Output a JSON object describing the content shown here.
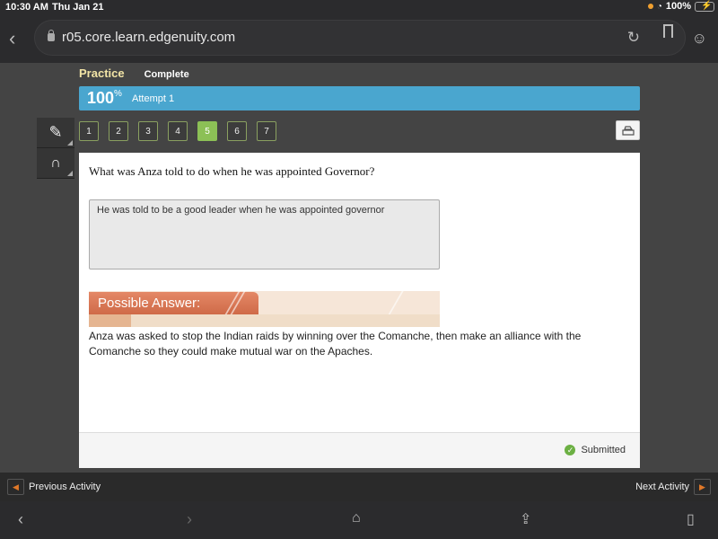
{
  "status_bar": {
    "time": "10:30 AM",
    "date": "Thu Jan 21",
    "battery": "100%",
    "icons": [
      "recording-dot-icon",
      "wifi-icon",
      "battery-charging-icon"
    ]
  },
  "browser": {
    "url": "r05.core.learn.edgenuity.com",
    "icons": [
      "back-icon",
      "lock-icon",
      "reload-icon",
      "bookmark-icon",
      "reader-icon"
    ]
  },
  "activity": {
    "mode": "Practice",
    "status": "Complete",
    "score": "100",
    "score_suffix": "%",
    "attempt": "Attempt 1",
    "accent_color": "#4aa6cf"
  },
  "tools": [
    {
      "icon": "pencil-icon"
    },
    {
      "icon": "headphones-icon"
    }
  ],
  "question_nav": {
    "items": [
      "1",
      "2",
      "3",
      "4",
      "5",
      "6",
      "7"
    ],
    "active": "5"
  },
  "question": {
    "text": "What was Anza told to do when he was appointed Governor?",
    "response": "He was told to be a good leader when he was appointed governor",
    "possible_answer_label": "Possible Answer:",
    "possible_answer": "Anza was asked to stop the Indian raids by winning over the Comanche, then make an alliance with the Comanche so they could make mutual war on the Apaches.",
    "submission_status": "Submitted"
  },
  "activity_nav": {
    "previous": "Previous Activity",
    "next": "Next Activity"
  }
}
